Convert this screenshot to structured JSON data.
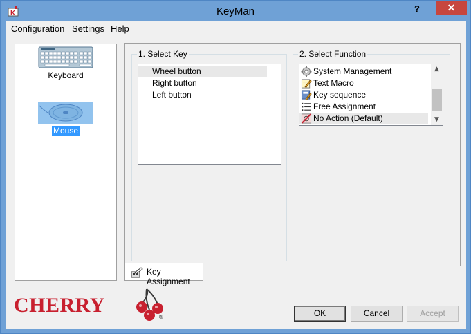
{
  "window": {
    "title": "KeyMan",
    "help_label": "?",
    "close_label": "✕"
  },
  "menu": {
    "items": [
      "Configuration",
      "Settings",
      "Help"
    ]
  },
  "devices": {
    "keyboard_label": "Keyboard",
    "mouse_label": "Mouse",
    "selected": "Mouse"
  },
  "select_key": {
    "title": "1. Select Key",
    "items": [
      "Wheel button",
      "Right button",
      "Left button"
    ],
    "highlighted": "Wheel button"
  },
  "select_function": {
    "title": "2. Select Function",
    "items": [
      {
        "label": "System Management",
        "icon": "gear-icon"
      },
      {
        "label": "Text Macro",
        "icon": "text-macro-icon"
      },
      {
        "label": "Key sequence",
        "icon": "key-sequence-icon"
      },
      {
        "label": "Free Assignment",
        "icon": "list-icon"
      },
      {
        "label": "No Action (Default)",
        "icon": "no-action-icon"
      }
    ],
    "selected": "No Action (Default)"
  },
  "tab": {
    "label": "Key Assignment"
  },
  "brand": {
    "logo_text": "CHERRY",
    "registered_mark": "®",
    "color": "#c8202f"
  },
  "buttons": {
    "ok": "OK",
    "cancel": "Cancel",
    "accept": "Accept"
  },
  "colors": {
    "titlebar": "#6fa1d6",
    "close": "#c7463e",
    "selection": "#3399ff"
  }
}
